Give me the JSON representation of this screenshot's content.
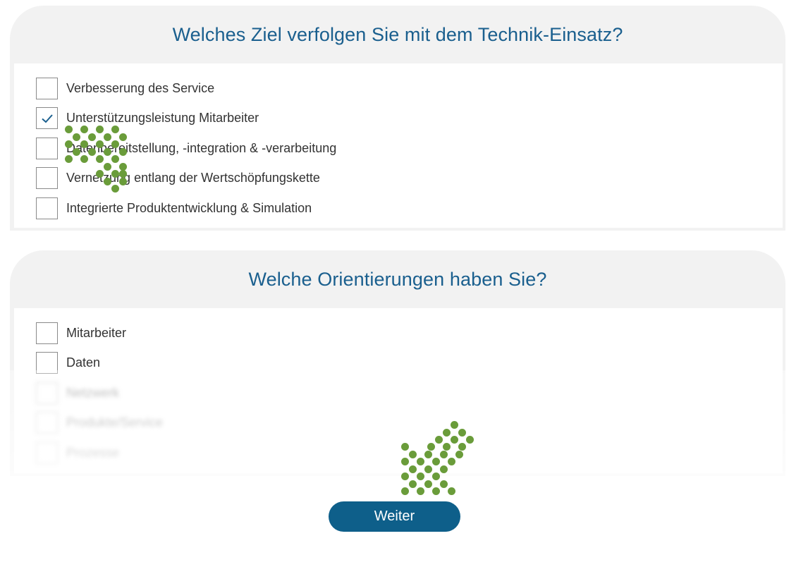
{
  "question1": {
    "title": "Welches Ziel verfolgen Sie mit dem Technik-Einsatz?",
    "options": [
      {
        "label": "Verbesserung des Service",
        "checked": false
      },
      {
        "label": "Unterstützungsleistung Mitarbeiter",
        "checked": true
      },
      {
        "label": "Datenbereitstellung, -integration & -verarbeitung",
        "checked": false
      },
      {
        "label": "Vernetzung entlang der Wertschöpfungskette",
        "checked": false
      },
      {
        "label": "Integrierte Produktentwicklung & Simulation",
        "checked": false
      }
    ]
  },
  "question2": {
    "title": "Welche Orientierungen haben Sie?",
    "options": [
      {
        "label": "Mitarbeiter",
        "checked": false
      },
      {
        "label": "Daten",
        "checked": false
      },
      {
        "label": "Netzwerk",
        "checked": false
      },
      {
        "label": "Produkte/Service",
        "checked": false
      },
      {
        "label": "Prozesse",
        "checked": false
      }
    ]
  },
  "continue_button": {
    "label": "Weiter"
  },
  "colors": {
    "accent": "#0e5f8a",
    "title": "#1a5f8e",
    "card_background": "#f2f2f2",
    "decoration_dots": "#6a9c3a"
  },
  "icons": {
    "checked": "checkmark-icon",
    "decoration": "dot-pattern-arrow-icon"
  }
}
